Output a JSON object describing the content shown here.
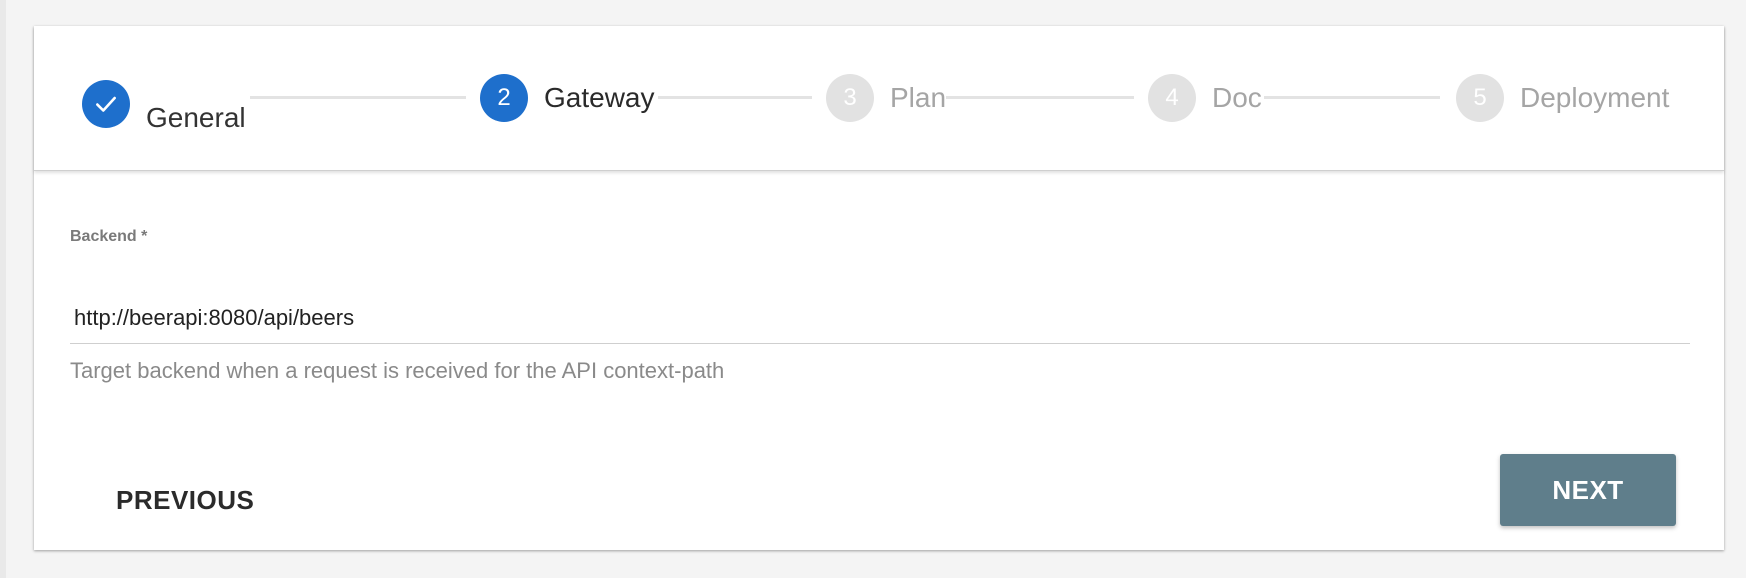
{
  "stepper": {
    "steps": [
      {
        "number": "1",
        "label": "General",
        "status": "completed",
        "icon": "check-icon"
      },
      {
        "number": "2",
        "label": "Gateway",
        "status": "active"
      },
      {
        "number": "3",
        "label": "Plan",
        "status": "inactive"
      },
      {
        "number": "4",
        "label": "Doc",
        "status": "inactive"
      },
      {
        "number": "5",
        "label": "Deployment",
        "status": "inactive"
      }
    ]
  },
  "form": {
    "backend_label": "Backend *",
    "backend_value": "http://beerapi:8080/api/beers",
    "backend_hint": "Target backend when a request is received for the API context-path"
  },
  "actions": {
    "previous_label": "PREVIOUS",
    "next_label": "NEXT"
  },
  "colors": {
    "accent": "#1e6fcc",
    "next_button": "#5f7e8b",
    "inactive_step": "#e2e2e2"
  }
}
